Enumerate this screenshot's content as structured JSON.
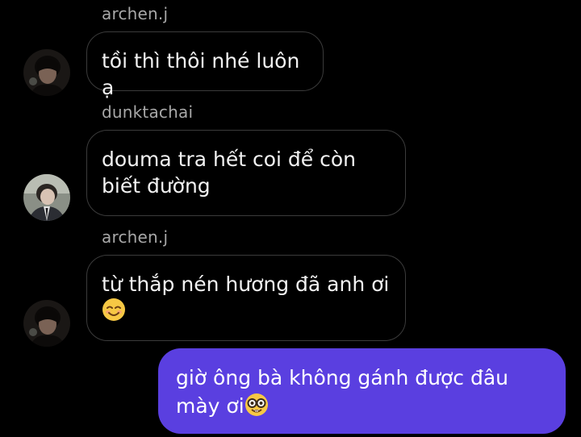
{
  "messages": [
    {
      "sender": "archen.j",
      "text": "tồi thì thôi nhé luôn ạ"
    },
    {
      "sender": "dunktachai",
      "text_line1": "douma tra hết coi để còn",
      "text_line2": "biết đường"
    },
    {
      "sender": "archen.j",
      "text": "từ thắp nén hương đã anh ơi",
      "emoji": "smiling-face-with-smiling-eyes"
    },
    {
      "outgoing": true,
      "text_line1": "giờ ông bà không gánh được đâu",
      "text_line2": "mày ơi",
      "emoji": "nerd-face"
    }
  ],
  "colors": {
    "background": "#000000",
    "incoming_border": "#3b3b3b",
    "outgoing_bubble": "#5a3fe0",
    "sender_name": "#a8a8a8"
  }
}
